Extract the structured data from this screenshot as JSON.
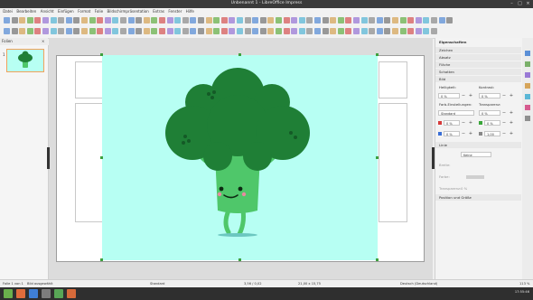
{
  "window": {
    "title": "Unbenannt 1 - LibreOffice Impress"
  },
  "menu": [
    "Datei",
    "Bearbeiten",
    "Ansicht",
    "Einfügen",
    "Format",
    "Folie",
    "Bildschirmpräsentation",
    "Extras",
    "Fenster",
    "Hilfe"
  ],
  "panes": {
    "title": "Folien",
    "close": "×",
    "slide_number": "1"
  },
  "sidebar": {
    "title": "Eigenschaften",
    "sections": [
      "Zeichen",
      "Absatz",
      "Fläche",
      "Schatten",
      "Bild"
    ],
    "bild": {
      "helligkeit_label": "Helligkeit:",
      "helligkeit_value": "0 %",
      "kontrast_label": "Kontrast:",
      "kontrast_value": "0 %",
      "farbe_label": "Farb-Einstellungen:",
      "farbe_value": "Standard",
      "transparenz_label": "Transparenz:",
      "transparenz_value": "0 %",
      "red_value": "0 %",
      "green_value": "0 %",
      "blue_value": "0 %",
      "gamma_value": "1,00"
    },
    "linie": {
      "title": "Linie",
      "stil_value": "Keine",
      "breite_label": "Breite:",
      "farbe_label": "Farbe:",
      "transparenz_label": "Transparenz:",
      "transparenz_value": "0 %"
    },
    "position_title": "Position und Größe"
  },
  "status": {
    "slide": "Folie 1 von 1",
    "selection": "Bild ausgewählt",
    "layout": "Standard",
    "position": "3,56 / 0,02",
    "size": "21,00 x 15,75",
    "language": "Deutsch (Deutschland)",
    "zoom": "113 %"
  },
  "taskbar": {
    "clock": "17:55:46"
  },
  "colors": {
    "image_bg": "#b7fff3",
    "floret": "#1f7f36",
    "stalk": "#4fc76a",
    "handle": "#3ea03e"
  }
}
